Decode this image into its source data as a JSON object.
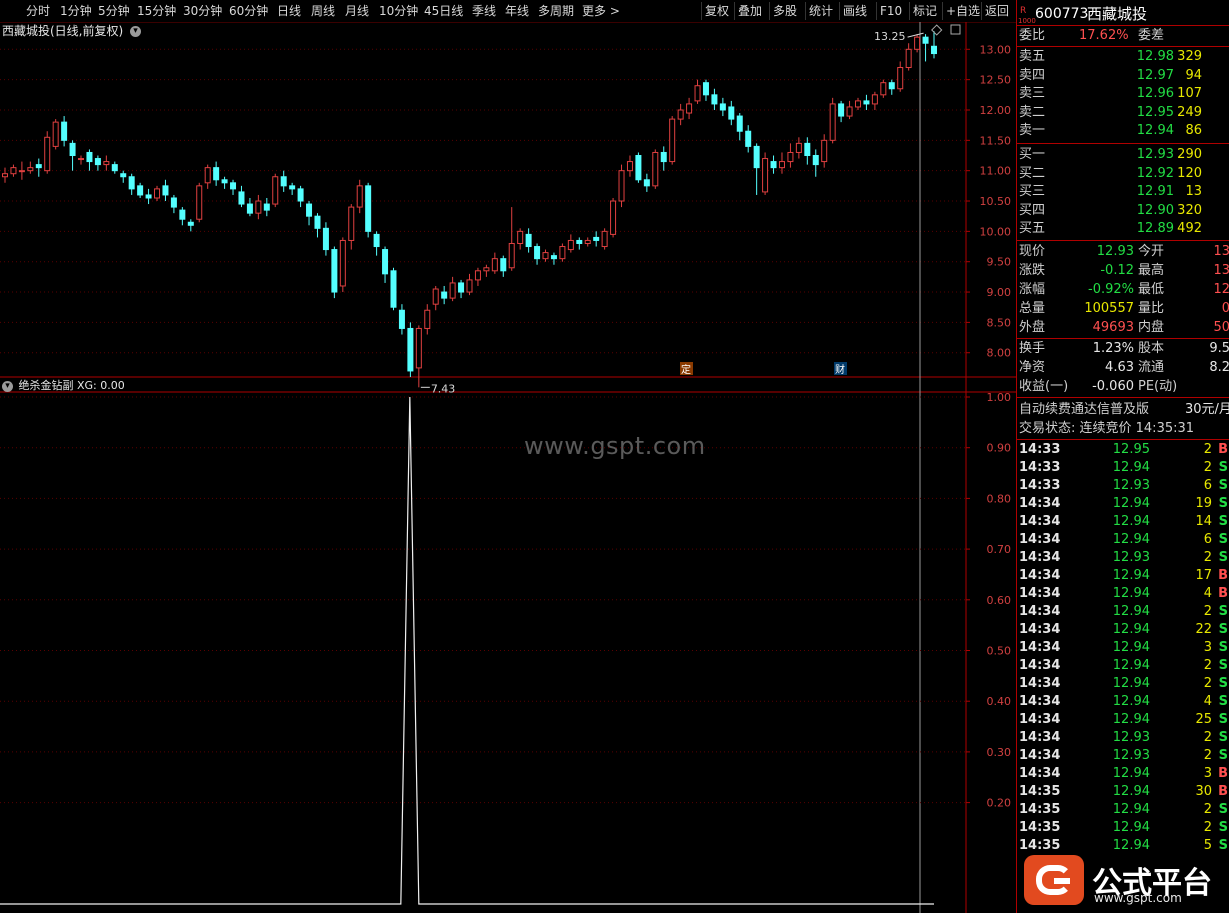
{
  "toolbar": {
    "periods": [
      "分时",
      "1分钟",
      "5分钟",
      "15分钟",
      "30分钟",
      "60分钟",
      "日线",
      "周线",
      "月线",
      "10分钟",
      "45日线",
      "季线",
      "年线",
      "多周期",
      "更多 >"
    ],
    "actions": [
      "复权",
      "叠加",
      "多股",
      "统计",
      "画线",
      "F10",
      "标记",
      "+自选",
      "返回"
    ]
  },
  "main_chart": {
    "title": "西藏城投(日线,前复权)",
    "high_label": "13.25",
    "low_label": "7.43",
    "marker_ding": "定",
    "marker_cai": "财",
    "y_ticks": [
      "13.00",
      "12.50",
      "12.00",
      "11.50",
      "11.00",
      "10.50",
      "10.00",
      "9.50",
      "9.00",
      "8.50",
      "8.00"
    ]
  },
  "sub_chart": {
    "title": "绝杀金钻副 XG: 0.00",
    "y_ticks": [
      "1.00",
      "0.90",
      "0.80",
      "0.70",
      "0.60",
      "0.50",
      "0.40",
      "0.30",
      "0.20"
    ]
  },
  "watermark": "www.gspt.com",
  "quote": {
    "badge": "R",
    "badge_sub": "1000",
    "code": "600773",
    "name": "西藏城投",
    "weibi_label": "委比",
    "weibi_value": "17.62%",
    "weicha_label": "委差",
    "asks": [
      {
        "label": "卖五",
        "price": "12.98",
        "vol": "329"
      },
      {
        "label": "卖四",
        "price": "12.97",
        "vol": "94"
      },
      {
        "label": "卖三",
        "price": "12.96",
        "vol": "107"
      },
      {
        "label": "卖二",
        "price": "12.95",
        "vol": "249"
      },
      {
        "label": "卖一",
        "price": "12.94",
        "vol": "86"
      }
    ],
    "bids": [
      {
        "label": "买一",
        "price": "12.93",
        "vol": "290"
      },
      {
        "label": "买二",
        "price": "12.92",
        "vol": "120"
      },
      {
        "label": "买三",
        "price": "12.91",
        "vol": "13"
      },
      {
        "label": "买四",
        "price": "12.90",
        "vol": "320"
      },
      {
        "label": "买五",
        "price": "12.89",
        "vol": "492"
      }
    ],
    "stats": [
      {
        "l1": "现价",
        "v1": "12.93",
        "l2": "今开",
        "v2": "13"
      },
      {
        "l1": "涨跌",
        "v1": "-0.12",
        "l2": "最高",
        "v2": "13"
      },
      {
        "l1": "涨幅",
        "v1": "-0.92%",
        "l2": "最低",
        "v2": "12"
      },
      {
        "l1": "总量",
        "v1": "100557",
        "l2": "量比",
        "v2": "0"
      },
      {
        "l1": "外盘",
        "v1": "49693",
        "l2": "内盘",
        "v2": "50"
      }
    ],
    "stats2": [
      {
        "l1": "换手",
        "v1": "1.23%",
        "l2": "股本",
        "v2": "9.5"
      },
      {
        "l1": "净资",
        "v1": "4.63",
        "l2": "流通",
        "v2": "8.2"
      },
      {
        "l1": "收益(一)",
        "v1": "-0.060",
        "l2": "PE(动)",
        "v2": ""
      }
    ],
    "promo": "自动续费通达信普及版",
    "promo_price": "30元/月",
    "trade_status": "交易状态: 连续竞价 14:35:31",
    "ticks": [
      {
        "t": "14:33",
        "p": "12.95",
        "v": "2",
        "s": "B"
      },
      {
        "t": "14:33",
        "p": "12.94",
        "v": "2",
        "s": "S"
      },
      {
        "t": "14:33",
        "p": "12.93",
        "v": "6",
        "s": "S"
      },
      {
        "t": "14:34",
        "p": "12.94",
        "v": "19",
        "s": "S"
      },
      {
        "t": "14:34",
        "p": "12.94",
        "v": "14",
        "s": "S"
      },
      {
        "t": "14:34",
        "p": "12.94",
        "v": "6",
        "s": "S"
      },
      {
        "t": "14:34",
        "p": "12.93",
        "v": "2",
        "s": "S"
      },
      {
        "t": "14:34",
        "p": "12.94",
        "v": "17",
        "s": "B"
      },
      {
        "t": "14:34",
        "p": "12.94",
        "v": "4",
        "s": "B"
      },
      {
        "t": "14:34",
        "p": "12.94",
        "v": "2",
        "s": "S"
      },
      {
        "t": "14:34",
        "p": "12.94",
        "v": "22",
        "s": "S"
      },
      {
        "t": "14:34",
        "p": "12.94",
        "v": "3",
        "s": "S"
      },
      {
        "t": "14:34",
        "p": "12.94",
        "v": "2",
        "s": "S"
      },
      {
        "t": "14:34",
        "p": "12.94",
        "v": "2",
        "s": "S"
      },
      {
        "t": "14:34",
        "p": "12.94",
        "v": "4",
        "s": "S"
      },
      {
        "t": "14:34",
        "p": "12.94",
        "v": "25",
        "s": "S"
      },
      {
        "t": "14:34",
        "p": "12.93",
        "v": "2",
        "s": "S"
      },
      {
        "t": "14:34",
        "p": "12.93",
        "v": "2",
        "s": "S"
      },
      {
        "t": "14:34",
        "p": "12.94",
        "v": "3",
        "s": "B"
      },
      {
        "t": "14:35",
        "p": "12.94",
        "v": "30",
        "s": "B"
      },
      {
        "t": "14:35",
        "p": "12.94",
        "v": "2",
        "s": "S"
      },
      {
        "t": "14:35",
        "p": "12.94",
        "v": "2",
        "s": "S"
      },
      {
        "t": "14:35",
        "p": "12.94",
        "v": "5",
        "s": "S"
      }
    ]
  },
  "logo": {
    "text": "公式平台",
    "url": "www.gspt.com"
  },
  "colors": {
    "up": "#e04040",
    "down": "#54ffff",
    "grid": "#8b0000",
    "ask_bid_price": "#22dd44"
  },
  "chart_data": {
    "type": "candlestick",
    "y_range": [
      7.6,
      13.45
    ],
    "candles": [
      [
        10.9,
        10.95,
        10.8,
        11.05
      ],
      [
        10.95,
        11.05,
        10.9,
        11.1
      ],
      [
        11.0,
        11.0,
        10.85,
        11.15
      ],
      [
        11.0,
        11.05,
        10.95,
        11.15
      ],
      [
        11.1,
        11.05,
        10.9,
        11.2
      ],
      [
        11.0,
        11.55,
        10.95,
        11.65
      ],
      [
        11.4,
        11.8,
        11.35,
        11.85
      ],
      [
        11.8,
        11.5,
        11.4,
        11.9
      ],
      [
        11.45,
        11.25,
        11.0,
        11.5
      ],
      [
        11.2,
        11.2,
        11.1,
        11.25
      ],
      [
        11.3,
        11.15,
        11.0,
        11.35
      ],
      [
        11.2,
        11.1,
        11.0,
        11.25
      ],
      [
        11.1,
        11.15,
        11.0,
        11.25
      ],
      [
        11.1,
        11.0,
        10.95,
        11.15
      ],
      [
        10.95,
        10.9,
        10.8,
        11.0
      ],
      [
        10.9,
        10.7,
        10.6,
        10.95
      ],
      [
        10.75,
        10.6,
        10.55,
        10.8
      ],
      [
        10.6,
        10.55,
        10.45,
        10.7
      ],
      [
        10.55,
        10.7,
        10.5,
        10.75
      ],
      [
        10.75,
        10.6,
        10.5,
        10.85
      ],
      [
        10.55,
        10.4,
        10.3,
        10.6
      ],
      [
        10.35,
        10.2,
        10.1,
        10.4
      ],
      [
        10.15,
        10.1,
        10.0,
        10.2
      ],
      [
        10.2,
        10.75,
        10.15,
        10.8
      ],
      [
        10.8,
        11.05,
        10.7,
        11.1
      ],
      [
        11.05,
        10.85,
        10.75,
        11.15
      ],
      [
        10.85,
        10.8,
        10.7,
        10.9
      ],
      [
        10.8,
        10.7,
        10.6,
        10.85
      ],
      [
        10.65,
        10.45,
        10.4,
        10.75
      ],
      [
        10.45,
        10.3,
        10.25,
        10.55
      ],
      [
        10.3,
        10.5,
        10.2,
        10.6
      ],
      [
        10.45,
        10.35,
        10.25,
        10.55
      ],
      [
        10.45,
        10.9,
        10.4,
        10.95
      ],
      [
        10.9,
        10.75,
        10.65,
        11.0
      ],
      [
        10.75,
        10.7,
        10.6,
        10.8
      ],
      [
        10.7,
        10.5,
        10.4,
        10.75
      ],
      [
        10.45,
        10.25,
        10.1,
        10.5
      ],
      [
        10.25,
        10.05,
        9.9,
        10.3
      ],
      [
        10.05,
        9.7,
        9.6,
        10.15
      ],
      [
        9.7,
        9.0,
        8.9,
        9.75
      ],
      [
        9.1,
        9.85,
        9.0,
        9.9
      ],
      [
        9.85,
        10.4,
        9.7,
        10.45
      ],
      [
        10.4,
        10.75,
        10.3,
        10.85
      ],
      [
        10.75,
        10.0,
        9.9,
        10.8
      ],
      [
        9.95,
        9.75,
        9.6,
        10.0
      ],
      [
        9.7,
        9.3,
        9.15,
        9.75
      ],
      [
        9.35,
        8.75,
        8.7,
        9.4
      ],
      [
        8.7,
        8.4,
        8.3,
        8.8
      ],
      [
        8.4,
        7.7,
        7.6,
        8.5
      ],
      [
        7.75,
        8.4,
        7.43,
        8.45
      ],
      [
        8.4,
        8.7,
        8.3,
        8.8
      ],
      [
        8.8,
        9.05,
        8.7,
        9.1
      ],
      [
        9.0,
        8.9,
        8.8,
        9.1
      ],
      [
        8.9,
        9.15,
        8.85,
        9.25
      ],
      [
        9.15,
        9.0,
        8.9,
        9.2
      ],
      [
        9.0,
        9.2,
        8.95,
        9.3
      ],
      [
        9.2,
        9.35,
        9.1,
        9.4
      ],
      [
        9.35,
        9.4,
        9.25,
        9.45
      ],
      [
        9.35,
        9.55,
        9.3,
        9.65
      ],
      [
        9.55,
        9.35,
        9.25,
        9.6
      ],
      [
        9.4,
        9.8,
        9.35,
        10.4
      ],
      [
        9.8,
        10.0,
        9.7,
        10.05
      ],
      [
        9.95,
        9.75,
        9.65,
        10.05
      ],
      [
        9.75,
        9.55,
        9.45,
        9.8
      ],
      [
        9.55,
        9.65,
        9.5,
        9.7
      ],
      [
        9.6,
        9.55,
        9.45,
        9.65
      ],
      [
        9.55,
        9.75,
        9.5,
        9.8
      ],
      [
        9.7,
        9.85,
        9.65,
        9.95
      ],
      [
        9.85,
        9.8,
        9.7,
        9.9
      ],
      [
        9.8,
        9.85,
        9.75,
        9.9
      ],
      [
        9.9,
        9.85,
        9.75,
        10.0
      ],
      [
        9.75,
        10.0,
        9.7,
        10.05
      ],
      [
        9.95,
        10.5,
        9.9,
        10.55
      ],
      [
        10.5,
        11.0,
        10.4,
        11.1
      ],
      [
        11.0,
        11.15,
        10.9,
        11.25
      ],
      [
        11.25,
        10.85,
        10.8,
        11.3
      ],
      [
        10.85,
        10.75,
        10.65,
        10.95
      ],
      [
        10.75,
        11.3,
        10.7,
        11.35
      ],
      [
        11.3,
        11.15,
        11.0,
        11.4
      ],
      [
        11.15,
        11.85,
        11.1,
        11.9
      ],
      [
        11.85,
        12.0,
        11.75,
        12.1
      ],
      [
        11.95,
        12.1,
        11.85,
        12.2
      ],
      [
        12.15,
        12.4,
        12.1,
        12.5
      ],
      [
        12.45,
        12.25,
        12.15,
        12.5
      ],
      [
        12.25,
        12.1,
        12.0,
        12.35
      ],
      [
        12.1,
        12.0,
        11.9,
        12.2
      ],
      [
        12.05,
        11.85,
        11.75,
        12.15
      ],
      [
        11.9,
        11.65,
        11.5,
        11.95
      ],
      [
        11.65,
        11.4,
        11.3,
        11.75
      ],
      [
        11.4,
        11.05,
        10.6,
        11.45
      ],
      [
        10.65,
        11.2,
        10.6,
        11.3
      ],
      [
        11.15,
        11.05,
        10.95,
        11.25
      ],
      [
        11.05,
        11.15,
        10.95,
        11.3
      ],
      [
        11.15,
        11.3,
        11.05,
        11.45
      ],
      [
        11.3,
        11.45,
        11.2,
        11.55
      ],
      [
        11.45,
        11.25,
        11.1,
        11.55
      ],
      [
        11.25,
        11.1,
        10.9,
        11.35
      ],
      [
        11.15,
        11.5,
        11.05,
        11.6
      ],
      [
        11.5,
        12.1,
        11.45,
        12.2
      ],
      [
        12.1,
        11.9,
        11.8,
        12.15
      ],
      [
        11.9,
        12.05,
        11.85,
        12.15
      ],
      [
        12.05,
        12.15,
        12.0,
        12.2
      ],
      [
        12.15,
        12.1,
        12.0,
        12.25
      ],
      [
        12.1,
        12.25,
        12.0,
        12.3
      ],
      [
        12.25,
        12.45,
        12.2,
        12.5
      ],
      [
        12.45,
        12.35,
        12.25,
        12.5
      ],
      [
        12.35,
        12.7,
        12.3,
        12.8
      ],
      [
        12.7,
        13.0,
        12.65,
        13.1
      ],
      [
        13.0,
        13.2,
        12.95,
        13.25
      ],
      [
        13.2,
        13.1,
        12.8,
        13.25
      ],
      [
        13.05,
        12.93,
        12.85,
        13.3
      ]
    ],
    "indicator": {
      "name": "XG",
      "spike_index": 49,
      "spike_value": 1.0,
      "base_value": 0.0
    }
  }
}
